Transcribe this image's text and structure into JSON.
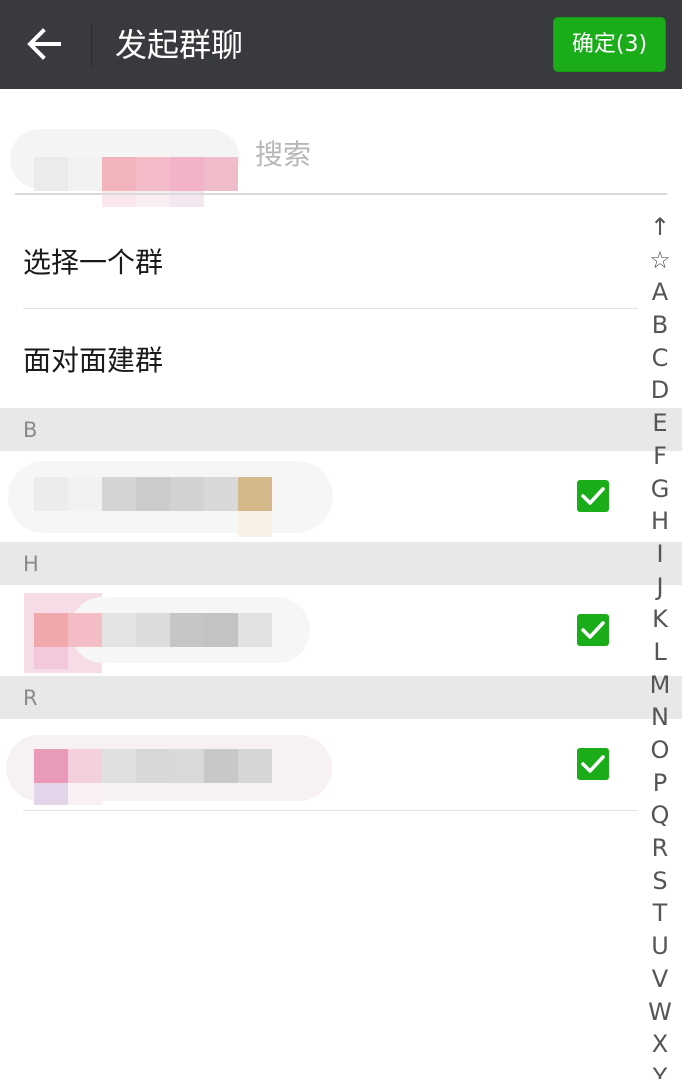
{
  "header": {
    "title": "发起群聊",
    "back_icon": "back-arrow-icon",
    "confirm_label": "确定(3)"
  },
  "search": {
    "placeholder": "搜索"
  },
  "menu": [
    {
      "label": "选择一个群"
    },
    {
      "label": "面对面建群"
    }
  ],
  "sections": [
    {
      "letter": "B",
      "checked": true
    },
    {
      "letter": "H",
      "checked": true
    },
    {
      "letter": "R",
      "checked": true
    }
  ],
  "index_bar": [
    "↑",
    "☆",
    "A",
    "B",
    "C",
    "D",
    "E",
    "F",
    "G",
    "H",
    "I",
    "J",
    "K",
    "L",
    "M",
    "N",
    "O",
    "P",
    "Q",
    "R",
    "S",
    "T",
    "U",
    "V",
    "W",
    "X",
    "Y"
  ],
  "colors": {
    "topbar": "#393a3e",
    "accent_green": "#1aad19",
    "section_bg": "#e8e8e8"
  }
}
